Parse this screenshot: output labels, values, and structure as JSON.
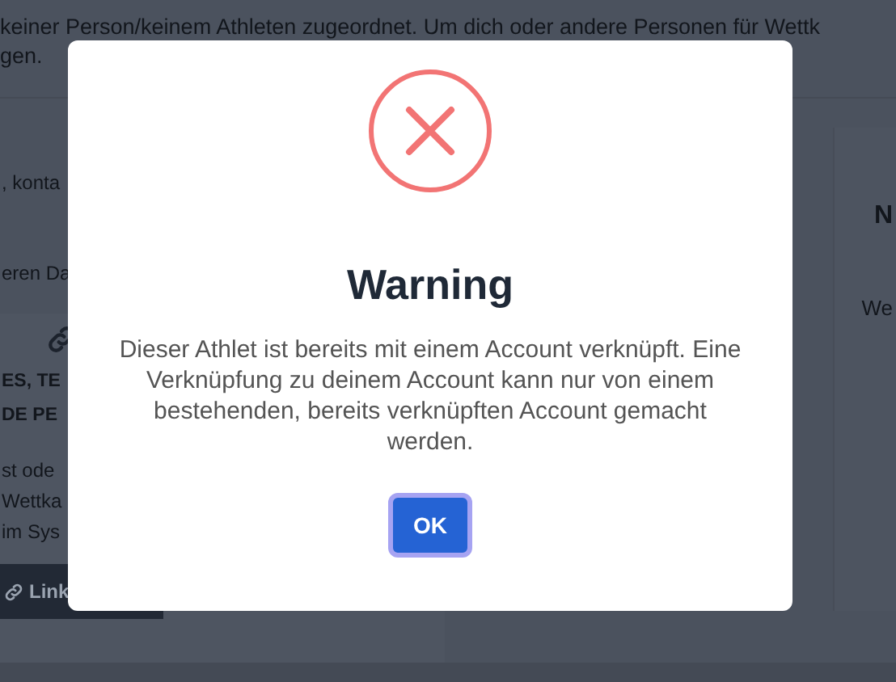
{
  "background": {
    "notice_lines": [
      "keiner Person/keinem Athleten zugeordnet. Um dich oder andere Personen für Wettk",
      "gen."
    ],
    "left_texts": [
      ", konta",
      "eren Da"
    ],
    "card_left": {
      "heading_lines": [
        "ES, TE",
        "DE PE"
      ],
      "body_lines": [
        "st ode",
        "Wettka",
        "im Sys"
      ],
      "button": "Link"
    },
    "card_right": {
      "heading": "N",
      "body": "We"
    }
  },
  "dialog": {
    "title": "Warning",
    "message": "Dieser Athlet ist bereits mit einem Account verknüpft. Eine Verknüpfung zu deinem Account kann nur von einem bestehenden, bereits verknüpften Account gemacht werden.",
    "button": "OK"
  }
}
